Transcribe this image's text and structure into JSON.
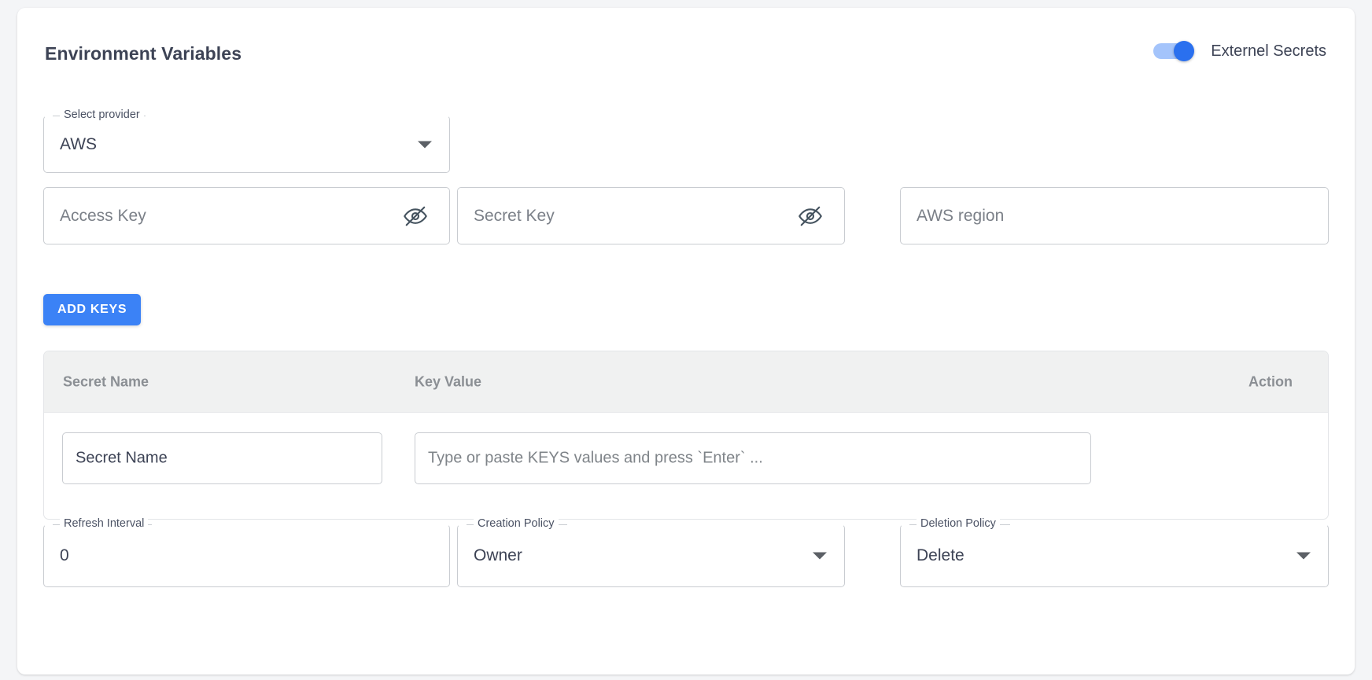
{
  "header": {
    "title": "Environment Variables",
    "toggle": {
      "label": "Externel Secrets",
      "state": "on",
      "on_color": "#2a70ef",
      "track_color": "#a4c4fb"
    }
  },
  "provider_select": {
    "legend": "Select provider",
    "value": "AWS",
    "options": [
      "AWS"
    ]
  },
  "credentials": [
    {
      "name": "access-key",
      "placeholder": "Access Key",
      "icon": "eye-off-icon",
      "has_icon": true
    },
    {
      "name": "secret-key",
      "placeholder": "Secret Key",
      "icon": "eye-off-icon",
      "has_icon": true
    },
    {
      "name": "aws-region",
      "placeholder": "AWS region",
      "icon": "",
      "has_icon": false
    }
  ],
  "buttons": {
    "add_keys": "ADD KEYS",
    "add_keys_color": "#3b82f6"
  },
  "secrets_table": {
    "columns": [
      "Secret Name",
      "Key Value",
      "Action"
    ],
    "rows": [
      {
        "secret_name_placeholder": "Secret Name",
        "key_value_placeholder": "Type or paste KEYS values and press `Enter` ..."
      }
    ]
  },
  "policies": {
    "refresh_interval": {
      "legend": "Refresh Interval",
      "value": "0"
    },
    "creation_policy": {
      "legend": "Creation Policy",
      "value": "Owner",
      "options": [
        "Owner"
      ]
    },
    "deletion_policy": {
      "legend": "Deletion Policy",
      "value": "Delete",
      "options": [
        "Delete"
      ]
    }
  }
}
